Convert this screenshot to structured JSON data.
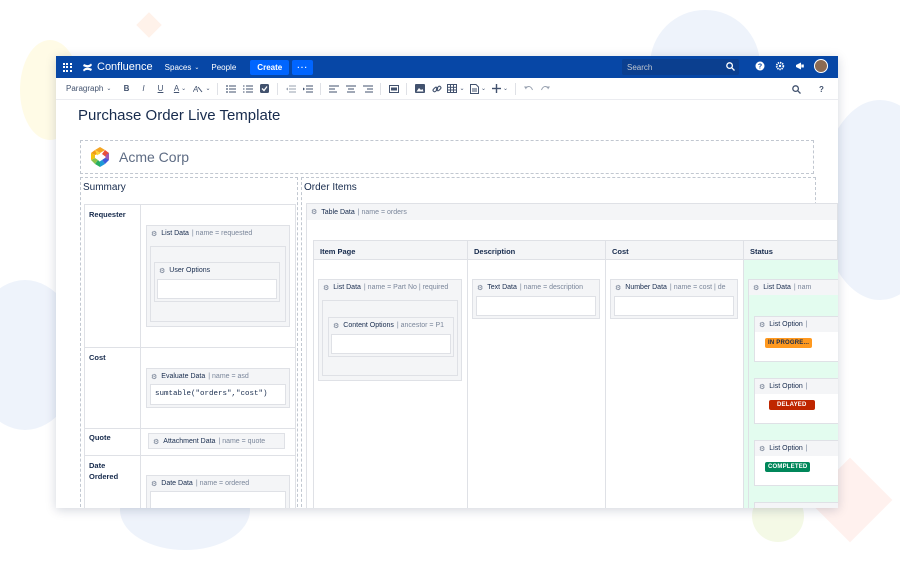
{
  "nav": {
    "brand": "Confluence",
    "spaces": "Spaces",
    "people": "People",
    "create": "Create",
    "more": "···",
    "search_placeholder": "Search"
  },
  "toolbar": {
    "paragraph": "Paragraph",
    "bold": "B",
    "italic": "I",
    "underline": "U",
    "text_color": "A"
  },
  "page": {
    "title": "Purchase Order Live Template",
    "company": "Acme Corp"
  },
  "summary": {
    "title": "Summary",
    "rows": {
      "requester": "Requester",
      "cost": "Cost",
      "quote": "Quote",
      "date_ordered": "Date Ordered"
    },
    "macros": {
      "list_data": {
        "name": "List Data",
        "params": "name = requested"
      },
      "user_options": {
        "name": "User Options"
      },
      "evaluate_data": {
        "name": "Evaluate Data",
        "params": "name = asd"
      },
      "evaluate_expr": "sumtable(\"orders\",\"cost\")",
      "attachment_data": {
        "name": "Attachment Data",
        "params": "name = quote"
      },
      "date_data": {
        "name": "Date Data",
        "params": "name = ordered"
      }
    }
  },
  "orders": {
    "title": "Order Items",
    "table_data": {
      "name": "Table Data",
      "params": "name = orders"
    },
    "columns": [
      "Item Page",
      "Description",
      "Cost",
      "Status"
    ],
    "cells": {
      "item_list": {
        "name": "List Data",
        "params": "name = Part No | required"
      },
      "content_options": {
        "name": "Content Options",
        "params": "ancestor = P1"
      },
      "text_data": {
        "name": "Text Data",
        "params": "name = description"
      },
      "number_data": {
        "name": "Number Data",
        "params": "name = cost | de"
      },
      "status_list": {
        "name": "List Data",
        "params": "nam"
      },
      "list_option": "List Option"
    },
    "statuses": [
      {
        "label": "IN PROGRE...",
        "color": "#ff991f"
      },
      {
        "label": "DELAYED",
        "color": "#bf2600"
      },
      {
        "label": "COMPLETED",
        "color": "#00875a"
      }
    ]
  },
  "colors": {
    "nav": "#0747a6",
    "create": "#0065ff",
    "status_col_bg": "#e3fcef"
  }
}
